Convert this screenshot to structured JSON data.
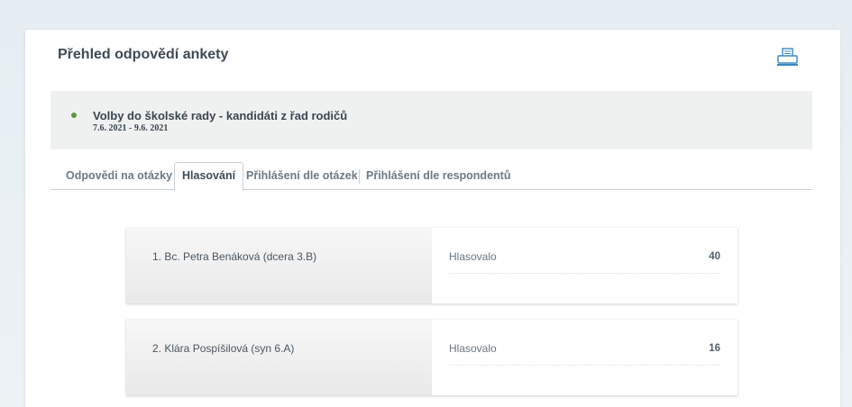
{
  "page": {
    "title": "Přehled odpovědí ankety"
  },
  "poll": {
    "title": "Volby do školské rady - kandidáti z řad rodičů",
    "dates": "7.6. 2021 - 9.6. 2021",
    "status_color": "#5a9a3c"
  },
  "toolbar": {
    "print_icon": "printer-icon"
  },
  "tabs": [
    {
      "label": "Odpovědi na otázky",
      "active": false
    },
    {
      "label": "Hlasování",
      "active": true
    },
    {
      "label": "Přihlášení dle otázek",
      "active": false
    },
    {
      "label": "Přihlášení dle respondentů",
      "active": false
    }
  ],
  "results": [
    {
      "name": "1. Bc. Petra Benáková (dcera 3.B)",
      "label": "Hlasovalo",
      "value": "40"
    },
    {
      "name": "2. Klára Pospíšilová (syn 6.A)",
      "label": "Hlasovalo",
      "value": "16"
    }
  ]
}
